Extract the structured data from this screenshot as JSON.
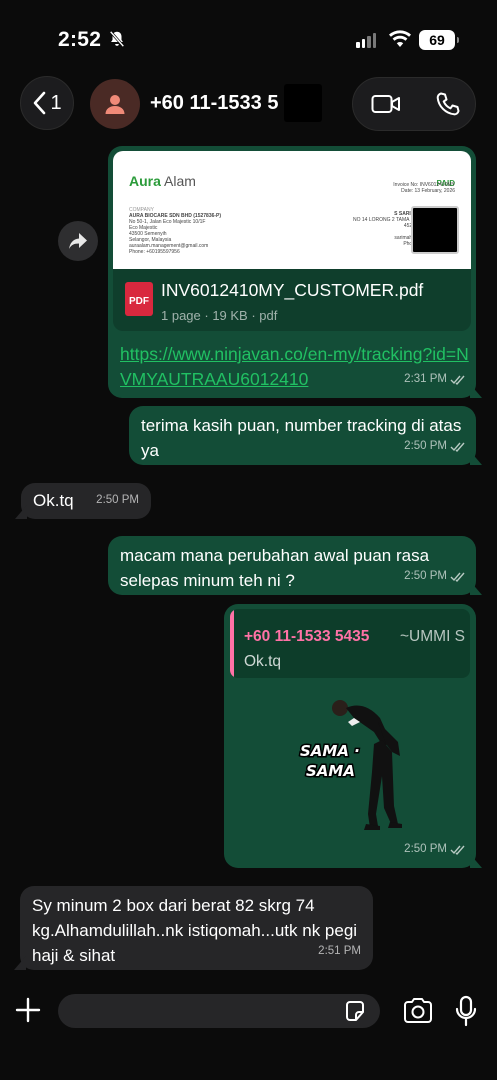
{
  "status_bar": {
    "time": "2:52",
    "battery": "69"
  },
  "header": {
    "back_count": "1",
    "contact_name": "+60 11-1533 5"
  },
  "messages": {
    "pdf": {
      "invoice": {
        "brand_main": "Aura",
        "brand_rest": " Alam",
        "status": "PAID",
        "invoice_no": "Invoice No: INV6012410MY",
        "date": "Date: 13 February, 2026",
        "company_label": "COMPANY",
        "company_name": "AURA BIOCARE SDN BHD (1527836-P)",
        "address_1": "No 50-1, Jalan Eco Majestic 10/1F",
        "address_2": "Eco Majestic",
        "address_3": "43500 Semenyih",
        "address_4": "Selangor, Malaysia",
        "email": "auraalam.management@gmail.com",
        "phone": "Phone: +60195597956",
        "recipient_name": "S SARIM",
        "recipient_address": "NO 14 LORONG 2 TAMA",
        "recipient_postcode": "4520",
        "recipient_email": "sarimaha",
        "recipient_phone": "Phon"
      },
      "file_name": "INV6012410MY_CUSTOMER.pdf",
      "file_info": "1 page · 19 KB · pdf",
      "file_icon_label": "PDF",
      "link": "https://www.ninjavan.co/en-my/tracking?id=NVMYAUTRAAU6012410",
      "time": "2:31 PM"
    },
    "m1": {
      "text": "terima kasih puan, number tracking di atas ya",
      "time": "2:50 PM"
    },
    "m2": {
      "text": "Ok.tq",
      "time": "2:50 PM"
    },
    "m3": {
      "text": "macam mana perubahan awal puan rasa selepas minum teh ni ?",
      "time": "2:50 PM"
    },
    "m4": {
      "quote_name": "+60 11-1533 5435",
      "quote_alias": "~UMMI S",
      "quote_text": "Ok.tq",
      "sticker_line1": "SAMA ·",
      "sticker_line2": "SAMA",
      "time": "2:50 PM"
    },
    "m5": {
      "text": "Sy minum 2 box dari berat 82 skrg 74 kg.Alhamdulillah..nk istiqomah...utk nk pegi haji & sihat",
      "time": "2:51 PM"
    }
  },
  "colors": {
    "outgoing": "#134d37",
    "incoming": "#262628",
    "link": "#21c063",
    "quote_accent": "#ff72a6"
  }
}
